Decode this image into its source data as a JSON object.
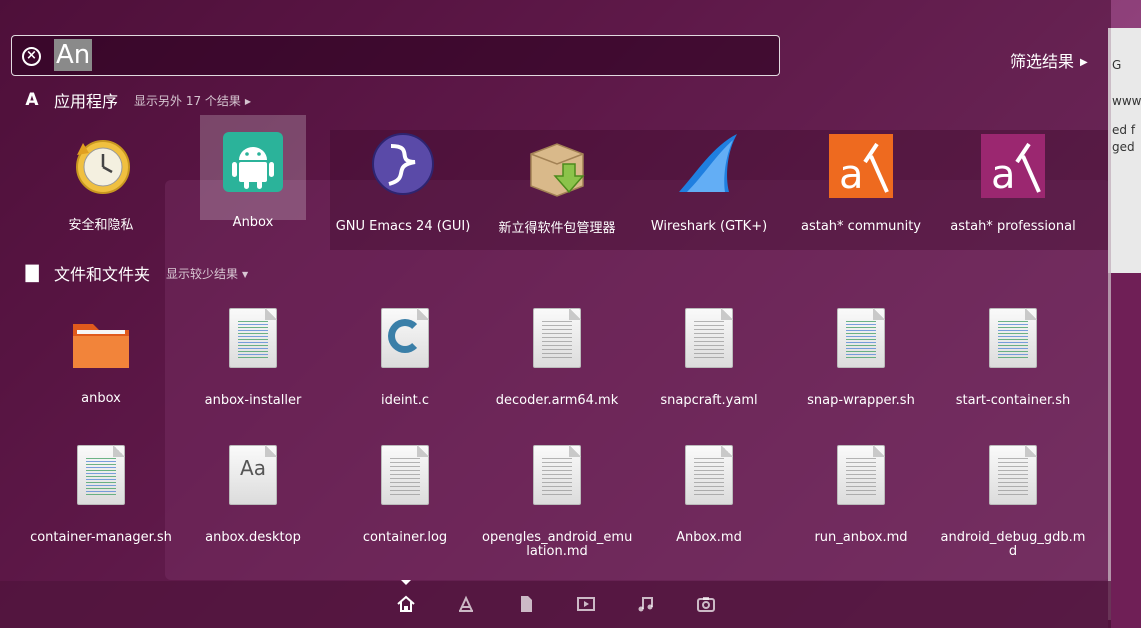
{
  "search": {
    "query": "An"
  },
  "filter": {
    "label": "筛选结果"
  },
  "apps_section": {
    "title": "应用程序",
    "more": "显示另外 17 个结果"
  },
  "apps": [
    {
      "label": "安全和隐私",
      "icon": "security-privacy-icon"
    },
    {
      "label": "Anbox",
      "icon": "android-icon"
    },
    {
      "label": "GNU Emacs 24 (GUI)",
      "icon": "emacs-icon"
    },
    {
      "label": "新立得软件包管理器",
      "icon": "package-manager-icon"
    },
    {
      "label": "Wireshark (GTK+)",
      "icon": "wireshark-icon"
    },
    {
      "label": "astah* community",
      "icon": "astah-community-icon"
    },
    {
      "label": "astah* professional",
      "icon": "astah-professional-icon"
    }
  ],
  "files_section": {
    "title": "文件和文件夹",
    "more": "显示较少结果"
  },
  "files_row1": [
    {
      "label": "anbox"
    },
    {
      "label": "anbox-installer"
    },
    {
      "label": "ideint.c"
    },
    {
      "label": "decoder.arm64.mk"
    },
    {
      "label": "snapcraft.yaml"
    },
    {
      "label": "snap-wrapper.sh"
    },
    {
      "label": "start-container.sh"
    }
  ],
  "files_row2": [
    {
      "label": "container-manager.sh"
    },
    {
      "label": "anbox.desktop"
    },
    {
      "label": "container.log"
    },
    {
      "label": "opengles_android_emu",
      "label2": "lation.md"
    },
    {
      "label": "Anbox.md"
    },
    {
      "label": "run_anbox.md"
    },
    {
      "label": "android_debug_gdb.m",
      "label2": "d"
    }
  ],
  "bg_text": [
    "G",
    "www",
    "ed f",
    "ged"
  ],
  "colors": {
    "accent": "#7a2a63",
    "ubuntu_orange": "#e95420"
  }
}
